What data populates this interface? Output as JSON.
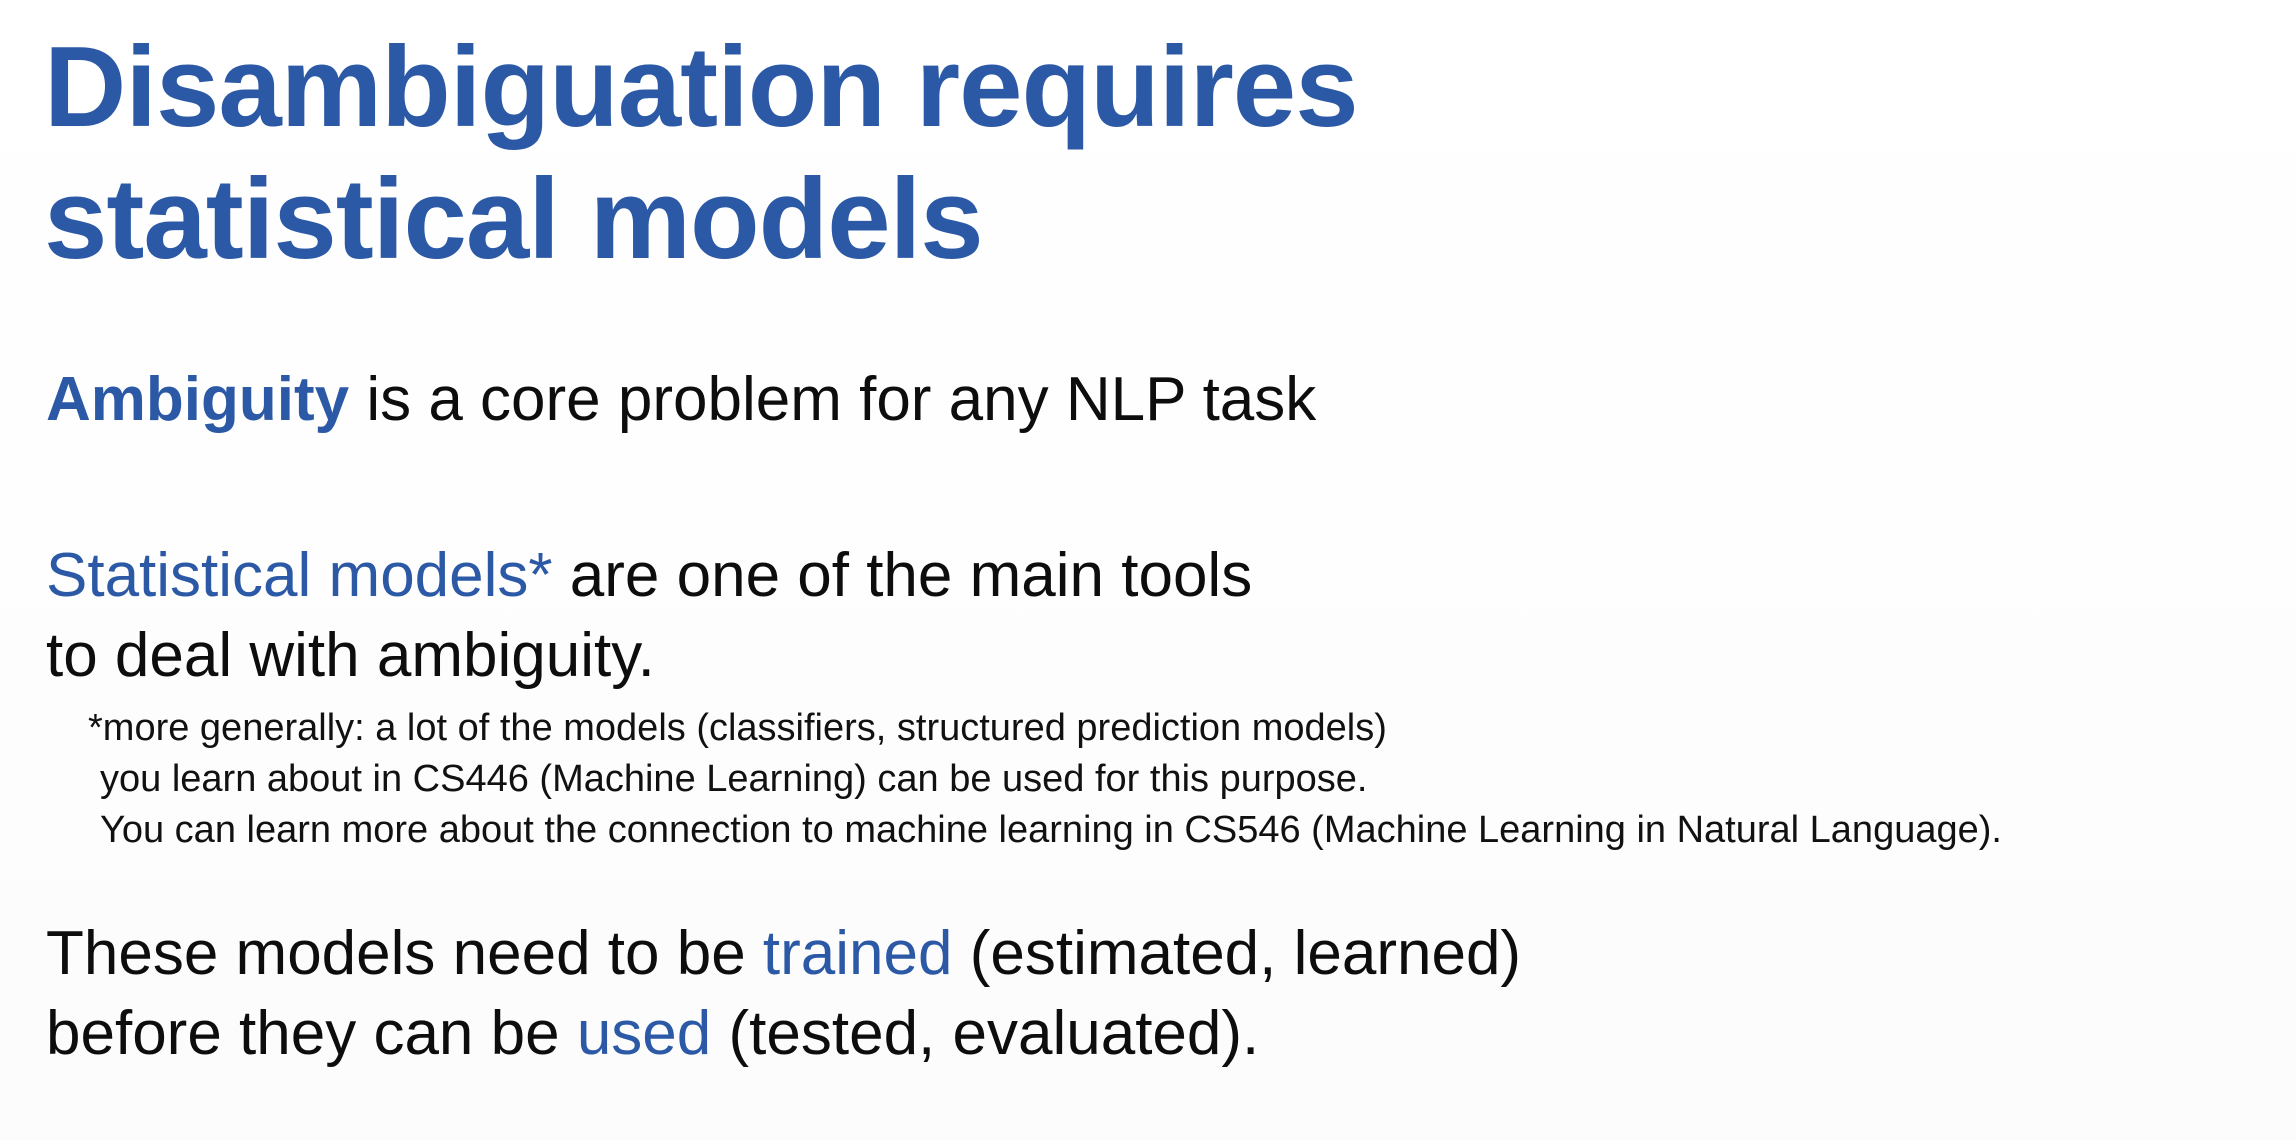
{
  "slide": {
    "title_line1": "Disambiguation requires",
    "title_line2": "statistical models",
    "p1": {
      "highlight": "Ambiguity",
      "rest": " is a core problem for any NLP task"
    },
    "p2": {
      "highlight": "Statistical models*",
      "rest_line1": " are one of the main tools",
      "line2": "to deal with ambiguity."
    },
    "footnote": {
      "line1": "*more generally: a lot of the models (classifiers, structured prediction models)",
      "line2": "you learn about in CS446 (Machine Learning) can be used for this purpose.",
      "line3": "You can learn more about the connection to machine learning in CS546 (Machine Learning in Natural Language)."
    },
    "p4": {
      "line1_pre": "These models need to be ",
      "line1_highlight": "trained",
      "line1_post": " (estimated, learned)",
      "line2_pre": "before they can be ",
      "line2_highlight": "used",
      "line2_post": " (tested, evaluated)."
    },
    "colors": {
      "accent_blue": "#2c59a6",
      "text": "#0d0d0d",
      "background": "#ffffff"
    }
  }
}
